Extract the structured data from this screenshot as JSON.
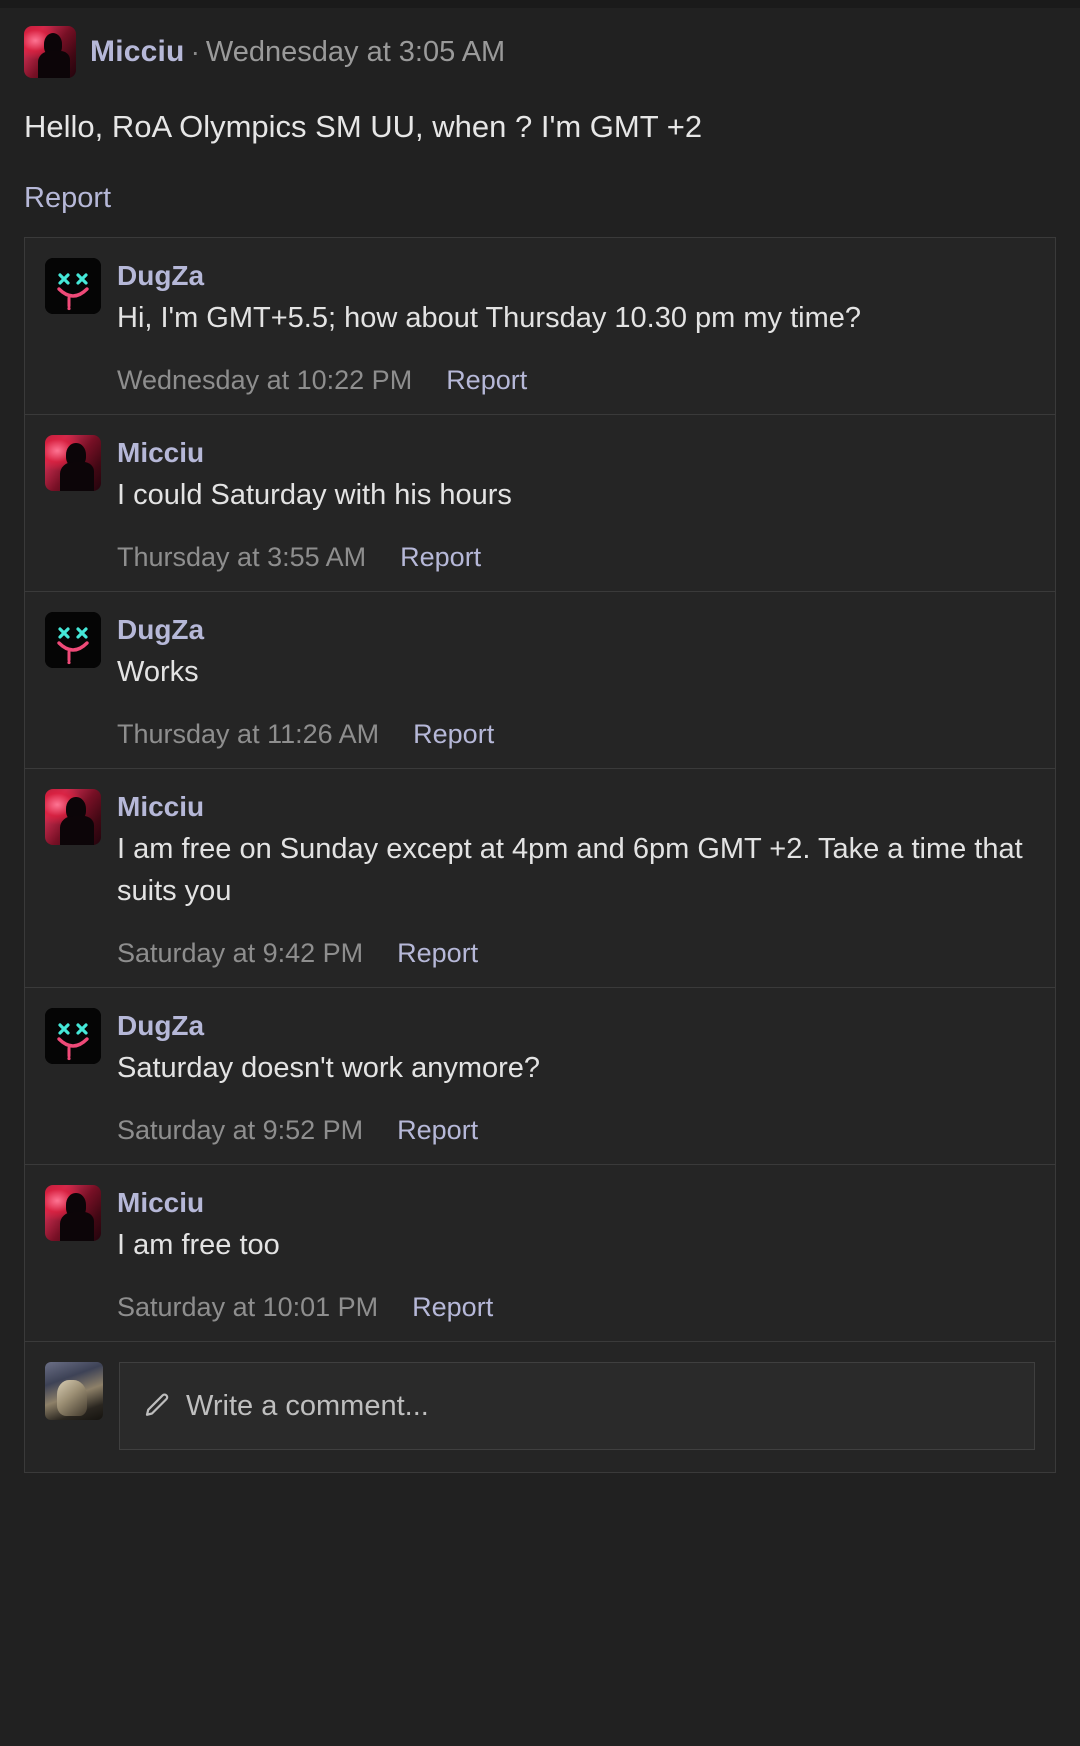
{
  "root_post": {
    "author": "Micciu",
    "separator": "·",
    "timestamp": "Wednesday at 3:05 AM",
    "body": "Hello, RoA Olympics SM UU, when ? I'm GMT +2",
    "report_label": "Report",
    "avatar_icon": "micciu-avatar"
  },
  "replies": [
    {
      "author": "DugZa",
      "avatar_icon": "dugza-avatar",
      "text": "Hi, I'm GMT+5.5; how about Thursday 10.30 pm my time?",
      "timestamp": "Wednesday at 10:22 PM",
      "report_label": "Report"
    },
    {
      "author": "Micciu",
      "avatar_icon": "micciu-avatar",
      "text": "I could Saturday with his hours",
      "timestamp": "Thursday at 3:55 AM",
      "report_label": "Report"
    },
    {
      "author": "DugZa",
      "avatar_icon": "dugza-avatar",
      "text": "Works",
      "timestamp": "Thursday at 11:26 AM",
      "report_label": "Report"
    },
    {
      "author": "Micciu",
      "avatar_icon": "micciu-avatar",
      "text": "I am free on Sunday except at 4pm and 6pm GMT +2. Take a time that suits you",
      "timestamp": "Saturday at 9:42 PM",
      "report_label": "Report"
    },
    {
      "author": "DugZa",
      "avatar_icon": "dugza-avatar",
      "text": "Saturday doesn't work anymore?",
      "timestamp": "Saturday at 9:52 PM",
      "report_label": "Report"
    },
    {
      "author": "Micciu",
      "avatar_icon": "micciu-avatar",
      "text": "I am free too",
      "timestamp": "Saturday at 10:01 PM",
      "report_label": "Report"
    }
  ],
  "composer": {
    "placeholder": "Write a comment...",
    "pencil_icon": "pencil-icon",
    "avatar_icon": "current-user-avatar"
  },
  "colors": {
    "page_background": "#212121",
    "card_background": "#252525",
    "border": "#3a3a3a",
    "link": "#b6b8d8",
    "muted_text": "#8e8e8e",
    "body_text": "#e3e3e3"
  }
}
